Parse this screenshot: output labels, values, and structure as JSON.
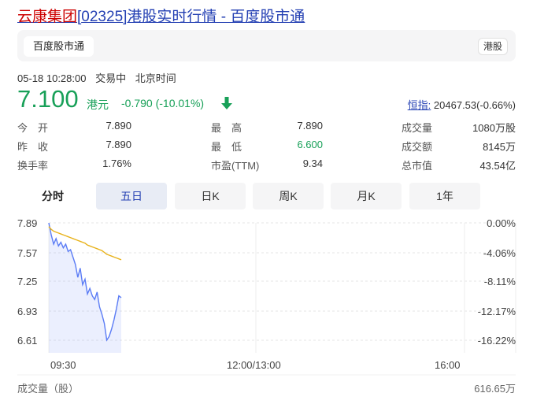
{
  "header": {
    "name": "云康集团",
    "code_open": "[",
    "code": "02325",
    "code_close": "]",
    "rest": "港股实时行情 - 百度股市通"
  },
  "tabbar": {
    "active_tab": "百度股市通",
    "market_badge": "港股"
  },
  "meta": {
    "datetime": "05-18 10:28:00",
    "status": "交易中",
    "tz": "北京时间"
  },
  "quote": {
    "price": "7.100",
    "unit": "港元",
    "change": "-0.790 (-10.01%)",
    "index_label": "恒指:",
    "index_value": "20467.53(-0.66%)",
    "trend_color": "#18a058"
  },
  "stats": [
    [
      {
        "label": "今　开",
        "value": "7.890"
      },
      {
        "label": "最　高",
        "value": "7.890"
      },
      {
        "label": "成交量",
        "value": "1080万股"
      }
    ],
    [
      {
        "label": "昨　收",
        "value": "7.890"
      },
      {
        "label": "最　低",
        "value": "6.600"
      },
      {
        "label": "成交额",
        "value": "8145万"
      }
    ],
    [
      {
        "label": "换手率",
        "value": "1.76%"
      },
      {
        "label": "市盈(TTM)",
        "value": "9.34"
      },
      {
        "label": "总市值",
        "value": "43.54亿"
      }
    ]
  ],
  "periods": [
    "分时",
    "五日",
    "日K",
    "周K",
    "月K",
    "1年"
  ],
  "chart_data": {
    "type": "line",
    "y_left_ticks": [
      "7.89",
      "7.57",
      "7.25",
      "6.93",
      "6.61"
    ],
    "y_right_ticks": [
      "0.00%",
      "-4.06%",
      "-8.11%",
      "-12.17%",
      "-16.22%"
    ],
    "x_ticks": [
      "09:30",
      "12:00/13:00",
      "16:00"
    ],
    "ylim": [
      6.61,
      7.89
    ],
    "series": [
      {
        "values": [
          7.89,
          7.76,
          7.66,
          7.72,
          7.64,
          7.68,
          7.62,
          7.66,
          7.58,
          7.6,
          7.52,
          7.44,
          7.3,
          7.4,
          7.22,
          7.28,
          7.12,
          7.18,
          7.1,
          7.06,
          7.14,
          6.98,
          6.9,
          6.8,
          6.62,
          6.66,
          6.74,
          6.84,
          6.96,
          7.1,
          7.08
        ],
        "color": "#5b7cf5"
      },
      {
        "values": [
          7.85,
          7.82,
          7.8,
          7.79,
          7.78,
          7.77,
          7.76,
          7.75,
          7.74,
          7.73,
          7.72,
          7.71,
          7.7,
          7.69,
          7.68,
          7.67,
          7.65,
          7.64,
          7.63,
          7.62,
          7.61,
          7.6,
          7.59,
          7.57,
          7.55,
          7.54,
          7.53,
          7.52,
          7.51,
          7.5,
          7.49
        ],
        "color": "#e8b21a"
      }
    ]
  },
  "volume": {
    "label": "成交量（股）",
    "value": "616.65万"
  }
}
